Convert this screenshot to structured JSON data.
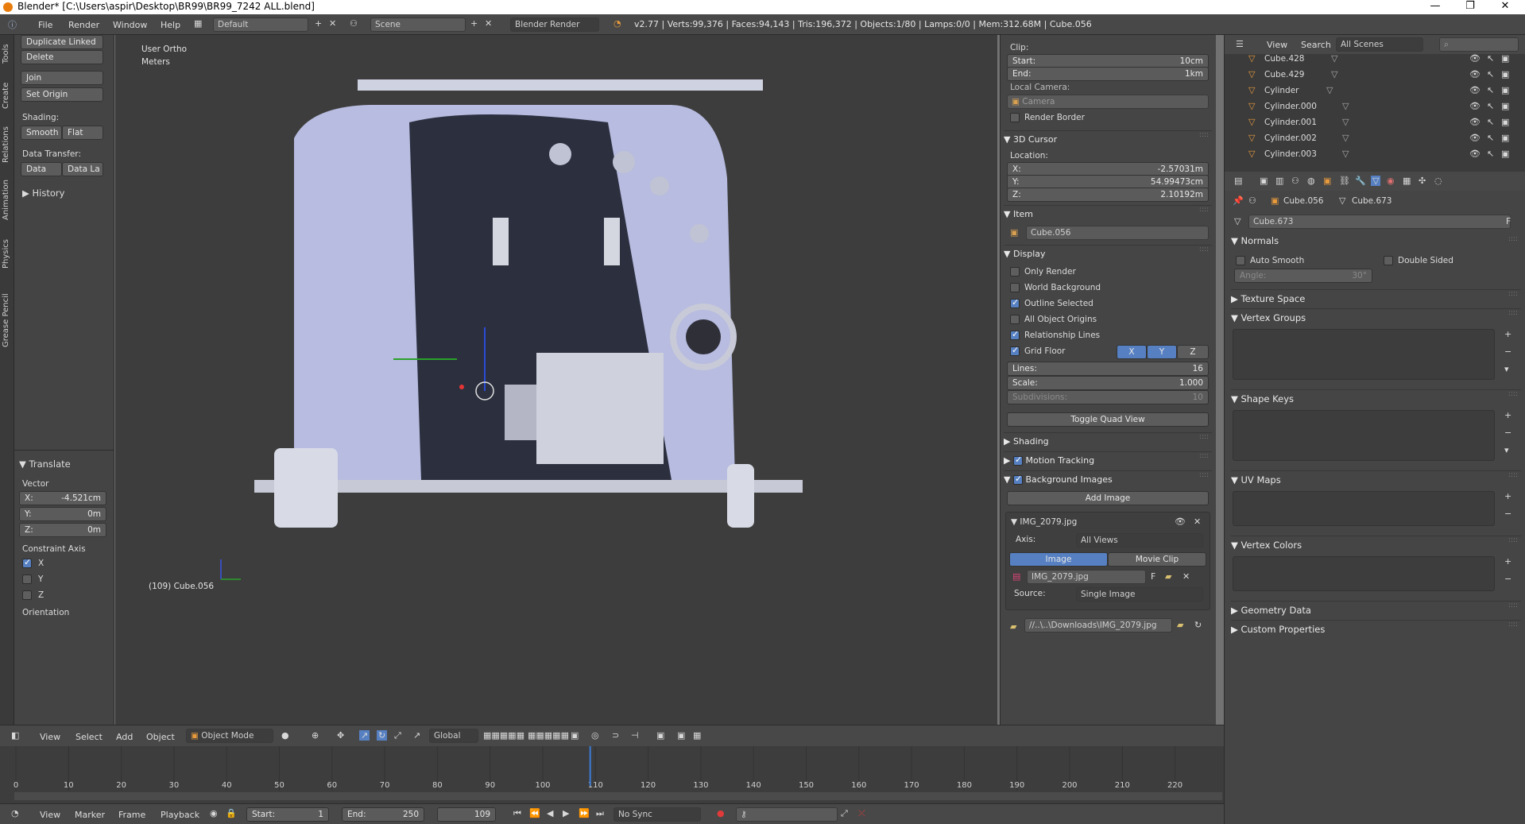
{
  "window": {
    "title": "Blender* [C:\\Users\\aspir\\Desktop\\BR99\\BR99_7242 ALL.blend]",
    "controls": [
      "—",
      "❐",
      "✕"
    ]
  },
  "info_header": {
    "menus": [
      "File",
      "Render",
      "Window",
      "Help"
    ],
    "screen_layout": "Default",
    "scene": "Scene",
    "render_engine": "Blender Render",
    "stats": "v2.77 | Verts:99,376 | Faces:94,143 | Tris:196,372 | Objects:1/80 | Lamps:0/0 | Mem:312.68M | Cube.056"
  },
  "tool_tabs": [
    "Tools",
    "Create",
    "Relations",
    "Animation",
    "Physics",
    "Grease Pencil"
  ],
  "tools_panel": {
    "buttons": [
      "Duplicate Linked",
      "Delete",
      "Join",
      "Set Origin"
    ],
    "shading_label": "Shading:",
    "shading_buttons": [
      "Smooth",
      "Flat"
    ],
    "data_transfer_label": "Data Transfer:",
    "data_transfer_buttons": [
      "Data",
      "Data La"
    ],
    "history": "History"
  },
  "translate": {
    "title": "Translate",
    "vector_label": "Vector",
    "x_label": "X:",
    "x": "-4.521cm",
    "y_label": "Y:",
    "y": "0m",
    "z_label": "Z:",
    "z": "0m",
    "constraint_label": "Constraint Axis",
    "axes": [
      {
        "name": "X",
        "checked": true
      },
      {
        "name": "Y",
        "checked": false
      },
      {
        "name": "Z",
        "checked": false
      }
    ],
    "orientation_label": "Orientation"
  },
  "viewport": {
    "view_name": "User Ortho",
    "units": "Meters",
    "status": "(109) Cube.056"
  },
  "npanel": {
    "clip_label": "Clip:",
    "start_label": "Start:",
    "start": "10cm",
    "end_label": "End:",
    "end": "1km",
    "local_camera_label": "Local Camera:",
    "camera": "Camera",
    "render_border": "Render Border",
    "cursor_title": "3D Cursor",
    "location_label": "Location:",
    "cx_label": "X:",
    "cx": "-2.57031m",
    "cy_label": "Y:",
    "cy": "54.99473cm",
    "cz_label": "Z:",
    "cz": "2.10192m",
    "item_title": "Item",
    "item_name": "Cube.056",
    "display_title": "Display",
    "display_options": [
      {
        "label": "Only Render",
        "checked": false
      },
      {
        "label": "World Background",
        "checked": false
      },
      {
        "label": "Outline Selected",
        "checked": true
      },
      {
        "label": "All Object Origins",
        "checked": false
      },
      {
        "label": "Relationship Lines",
        "checked": true
      }
    ],
    "grid_floor": "Grid Floor",
    "grid_axes": [
      "X",
      "Y",
      "Z"
    ],
    "lines_label": "Lines:",
    "lines": "16",
    "scale_label": "Scale:",
    "scale": "1.000",
    "subdiv_label": "Subdivisions:",
    "subdiv": "10",
    "toggle_quad": "Toggle Quad View",
    "shading": "Shading",
    "motion_tracking": "Motion Tracking",
    "background_images": "Background Images",
    "add_image": "Add Image",
    "image_name": "IMG_2079.jpg",
    "axis_label": "Axis:",
    "axis_value": "All Views",
    "tab_image": "Image",
    "tab_movie": "Movie Clip",
    "image_file": "IMG_2079.jpg",
    "f_label": "F",
    "source_label": "Source:",
    "source_value": "Single Image",
    "path": "//..\\..\\Downloads\\IMG_2079.jpg"
  },
  "outliner": {
    "menus": [
      "View",
      "Search"
    ],
    "filter": "All Scenes",
    "items": [
      "Cube.428",
      "Cube.429",
      "Cylinder",
      "Cylinder.000",
      "Cylinder.001",
      "Cylinder.002",
      "Cylinder.003"
    ]
  },
  "properties": {
    "object": "Cube.056",
    "mesh": "Cube.673",
    "data_name": "Cube.673",
    "fake_user": "F",
    "normals": "Normals",
    "auto_smooth": "Auto Smooth",
    "double_sided": "Double Sided",
    "angle_label": "Angle:",
    "angle": "30°",
    "sections": [
      "Texture Space",
      "Vertex Groups",
      "Shape Keys",
      "UV Maps",
      "Vertex Colors",
      "Geometry Data",
      "Custom Properties"
    ]
  },
  "view3d_header": {
    "menus": [
      "View",
      "Select",
      "Add",
      "Object"
    ],
    "mode": "Object Mode",
    "orientation": "Global"
  },
  "timeline": {
    "ticks": [
      "0",
      "10",
      "20",
      "30",
      "40",
      "50",
      "60",
      "70",
      "80",
      "90",
      "100",
      "110",
      "120",
      "130",
      "140",
      "150",
      "160",
      "170",
      "180",
      "190",
      "200",
      "210",
      "220"
    ],
    "current_frame": 109,
    "menus": [
      "View",
      "Marker",
      "Frame",
      "Playback"
    ],
    "start_label": "Start:",
    "start": "1",
    "end_label": "End:",
    "end": "250",
    "frame": "109",
    "sync": "No Sync"
  },
  "colors": {
    "accent": "#5680c2",
    "playhead": "#3d7bd6",
    "object_orange": "#e89a3c"
  }
}
